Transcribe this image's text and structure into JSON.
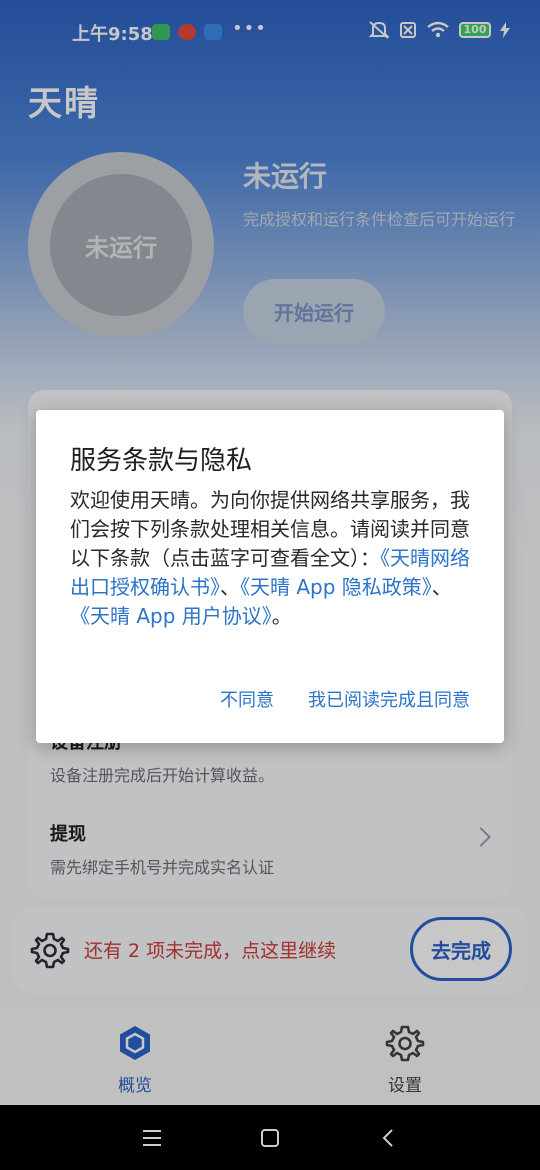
{
  "status_bar": {
    "time": "上午9:58",
    "more": "•••",
    "battery": "100"
  },
  "app": {
    "title": "天晴"
  },
  "run_status": {
    "ring_label": "未运行",
    "title": "未运行",
    "description": "完成授权和运行条件检查后可开始运行",
    "start_button": "开始运行"
  },
  "checklist": {
    "items": [
      {
        "title": "设备注册",
        "subtitle": "设备注册完成后开始计算收益。"
      },
      {
        "title": "提现",
        "subtitle": "需先绑定手机号并完成实名认证"
      }
    ]
  },
  "pending": {
    "text": "还有 2 项未完成，点这里继续",
    "button": "去完成"
  },
  "tabs": [
    {
      "label": "概览",
      "active": true,
      "icon": "hexagon-icon"
    },
    {
      "label": "设置",
      "active": false,
      "icon": "gear-icon"
    }
  ],
  "dialog": {
    "title": "服务条款与隐私",
    "body_intro": "欢迎使用天晴。为向你提供网络共享服务，我们会按下列条款处理相关信息。请阅读并同意以下条款（点击蓝字可查看全文）：",
    "link_1": "《天晴网络出口授权确认书》",
    "sep_1": "、",
    "link_2": "《天晴 App 隐私政策》",
    "sep_2": "、",
    "link_3": "《天晴 App 用户协议》",
    "body_end": "。",
    "disagree": "不同意",
    "agree": "我已阅读完成且同意"
  },
  "colors": {
    "accent": "#2c63c8",
    "link": "#2c73c9",
    "warning": "#d23d3d"
  }
}
